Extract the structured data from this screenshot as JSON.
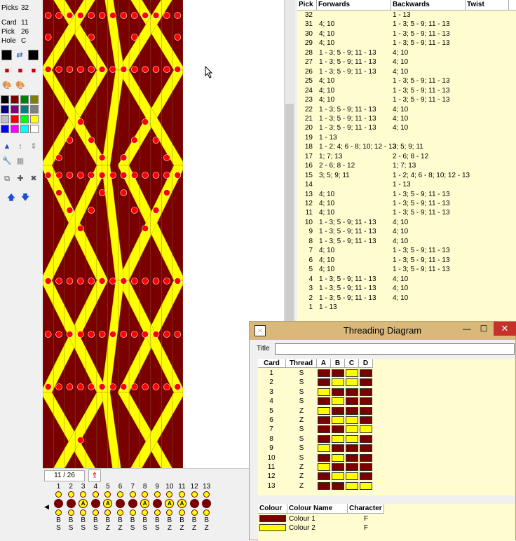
{
  "toolbar": {
    "picks_label": "Picks",
    "picks_value": "32",
    "card_label": "Card",
    "card_value": "11",
    "pick_label": "Pick",
    "pick_value": "26",
    "hole_label": "Hole",
    "hole_value": "C",
    "palette": [
      "#000000",
      "#800000",
      "#008000",
      "#808000",
      "#000080",
      "#800080",
      "#008080",
      "#808080",
      "#c0c0c0",
      "#ff0000",
      "#00ff00",
      "#ffff00",
      "#0000ff",
      "#ff00ff",
      "#00ffff",
      "#ffffff"
    ],
    "icons": [
      "swap-colours-icon",
      "colour-select-icon",
      "palette-icon",
      "palette-edit-icon",
      "weave-icon",
      "move-vertical-icon",
      "expand-vertical-icon",
      "tools-icon",
      "grid-icon",
      "copy-icon",
      "card-add-icon",
      "card-remove-icon",
      "arrow-up-icon",
      "arrow-down-icon"
    ]
  },
  "colors": {
    "dark": "#7a0000",
    "light": "#ffff00",
    "dot": "#ff0000",
    "bg": "#fffcd0"
  },
  "status": {
    "pick_position": "11 / 26"
  },
  "cards": {
    "numbers": [
      "1",
      "2",
      "3",
      "4",
      "5",
      "6",
      "7",
      "8",
      "9",
      "10",
      "11",
      "12",
      "13"
    ],
    "hole_letters": [
      "",
      "",
      "A",
      "",
      "A",
      "",
      "",
      "A",
      "",
      "A",
      "A",
      "",
      ""
    ],
    "labels_b": [
      "B",
      "B",
      "B",
      "B",
      "B",
      "B",
      "B",
      "B",
      "B",
      "B",
      "B",
      "B",
      "B"
    ],
    "threads": [
      "S",
      "S",
      "S",
      "S",
      "Z",
      "Z",
      "S",
      "S",
      "S",
      "Z",
      "Z",
      "Z",
      "Z"
    ]
  },
  "picks_table": {
    "headers": [
      "Pick",
      "Forwards",
      "Backwards",
      "Twist"
    ],
    "rows": [
      [
        "32",
        "",
        "1 - 13"
      ],
      [
        "31",
        "4; 10",
        "1 - 3; 5 - 9; 11 - 13"
      ],
      [
        "30",
        "4; 10",
        "1 - 3; 5 - 9; 11 - 13"
      ],
      [
        "29",
        "4; 10",
        "1 - 3; 5 - 9; 11 - 13"
      ],
      [
        "28",
        "1 - 3; 5 - 9; 11 - 13",
        "4; 10"
      ],
      [
        "27",
        "1 - 3; 5 - 9; 11 - 13",
        "4; 10"
      ],
      [
        "26",
        "1 - 3; 5 - 9; 11 - 13",
        "4; 10"
      ],
      [
        "25",
        "4; 10",
        "1 - 3; 5 - 9; 11 - 13"
      ],
      [
        "24",
        "4; 10",
        "1 - 3; 5 - 9; 11 - 13"
      ],
      [
        "23",
        "4; 10",
        "1 - 3; 5 - 9; 11 - 13"
      ],
      [
        "22",
        "1 - 3; 5 - 9; 11 - 13",
        "4; 10"
      ],
      [
        "21",
        "1 - 3; 5 - 9; 11 - 13",
        "4; 10"
      ],
      [
        "20",
        "1 - 3; 5 - 9; 11 - 13",
        "4; 10"
      ],
      [
        "19",
        "1 - 13",
        ""
      ],
      [
        "18",
        "1 - 2; 4; 6 - 8; 10; 12 - 13",
        "3; 5; 9; 11"
      ],
      [
        "17",
        "1; 7; 13",
        "2 - 6; 8 - 12"
      ],
      [
        "16",
        "2 - 6; 8 - 12",
        "1; 7; 13"
      ],
      [
        "15",
        "3; 5; 9; 11",
        "1 - 2; 4; 6 - 8; 10; 12 - 13"
      ],
      [
        "14",
        "",
        "1 - 13"
      ],
      [
        "13",
        "4; 10",
        "1 - 3; 5 - 9; 11 - 13"
      ],
      [
        "12",
        "4; 10",
        "1 - 3; 5 - 9; 11 - 13"
      ],
      [
        "11",
        "4; 10",
        "1 - 3; 5 - 9; 11 - 13"
      ],
      [
        "10",
        "1 - 3; 5 - 9; 11 - 13",
        "4; 10"
      ],
      [
        "9",
        "1 - 3; 5 - 9; 11 - 13",
        "4; 10"
      ],
      [
        "8",
        "1 - 3; 5 - 9; 11 - 13",
        "4; 10"
      ],
      [
        "7",
        "4; 10",
        "1 - 3; 5 - 9; 11 - 13"
      ],
      [
        "6",
        "4; 10",
        "1 - 3; 5 - 9; 11 - 13"
      ],
      [
        "5",
        "4; 10",
        "1 - 3; 5 - 9; 11 - 13"
      ],
      [
        "4",
        "1 - 3; 5 - 9; 11 - 13",
        "4; 10"
      ],
      [
        "3",
        "1 - 3; 5 - 9; 11 - 13",
        "4; 10"
      ],
      [
        "2",
        "1 - 3; 5 - 9; 11 - 13",
        "4; 10"
      ],
      [
        "1",
        "1 - 13",
        ""
      ]
    ]
  },
  "threading": {
    "window_title": "Threading Diagram",
    "title_label": "Title",
    "title_value": "",
    "headers": [
      "Card",
      "Thread",
      "A",
      "B",
      "C",
      "D"
    ],
    "rows": [
      {
        "card": "1",
        "thread": "S",
        "holes": [
          "D",
          "D",
          "Y",
          "D"
        ]
      },
      {
        "card": "2",
        "thread": "S",
        "holes": [
          "D",
          "Y",
          "Y",
          "D"
        ]
      },
      {
        "card": "3",
        "thread": "S",
        "holes": [
          "Y",
          "D",
          "D",
          "D"
        ]
      },
      {
        "card": "4",
        "thread": "S",
        "holes": [
          "D",
          "Y",
          "D",
          "D"
        ]
      },
      {
        "card": "5",
        "thread": "Z",
        "holes": [
          "Y",
          "D",
          "D",
          "D"
        ]
      },
      {
        "card": "6",
        "thread": "Z",
        "holes": [
          "D",
          "Y",
          "Y",
          "D"
        ]
      },
      {
        "card": "7",
        "thread": "S",
        "holes": [
          "D",
          "D",
          "Y",
          "Y"
        ]
      },
      {
        "card": "8",
        "thread": "S",
        "holes": [
          "D",
          "Y",
          "Y",
          "D"
        ]
      },
      {
        "card": "9",
        "thread": "S",
        "holes": [
          "Y",
          "D",
          "D",
          "D"
        ]
      },
      {
        "card": "10",
        "thread": "S",
        "holes": [
          "D",
          "Y",
          "D",
          "D"
        ]
      },
      {
        "card": "11",
        "thread": "Z",
        "holes": [
          "Y",
          "D",
          "D",
          "D"
        ]
      },
      {
        "card": "12",
        "thread": "Z",
        "holes": [
          "D",
          "Y",
          "Y",
          "D"
        ]
      },
      {
        "card": "13",
        "thread": "Z",
        "holes": [
          "D",
          "D",
          "Y",
          "Y"
        ]
      }
    ]
  },
  "colour_table": {
    "headers": [
      "Colour",
      "Colour Name",
      "Character"
    ],
    "rows": [
      {
        "name": "Colour 1",
        "char": "F",
        "color": "#7a0000"
      },
      {
        "name": "Colour 2",
        "char": "F",
        "color": "#ffff00"
      }
    ]
  }
}
